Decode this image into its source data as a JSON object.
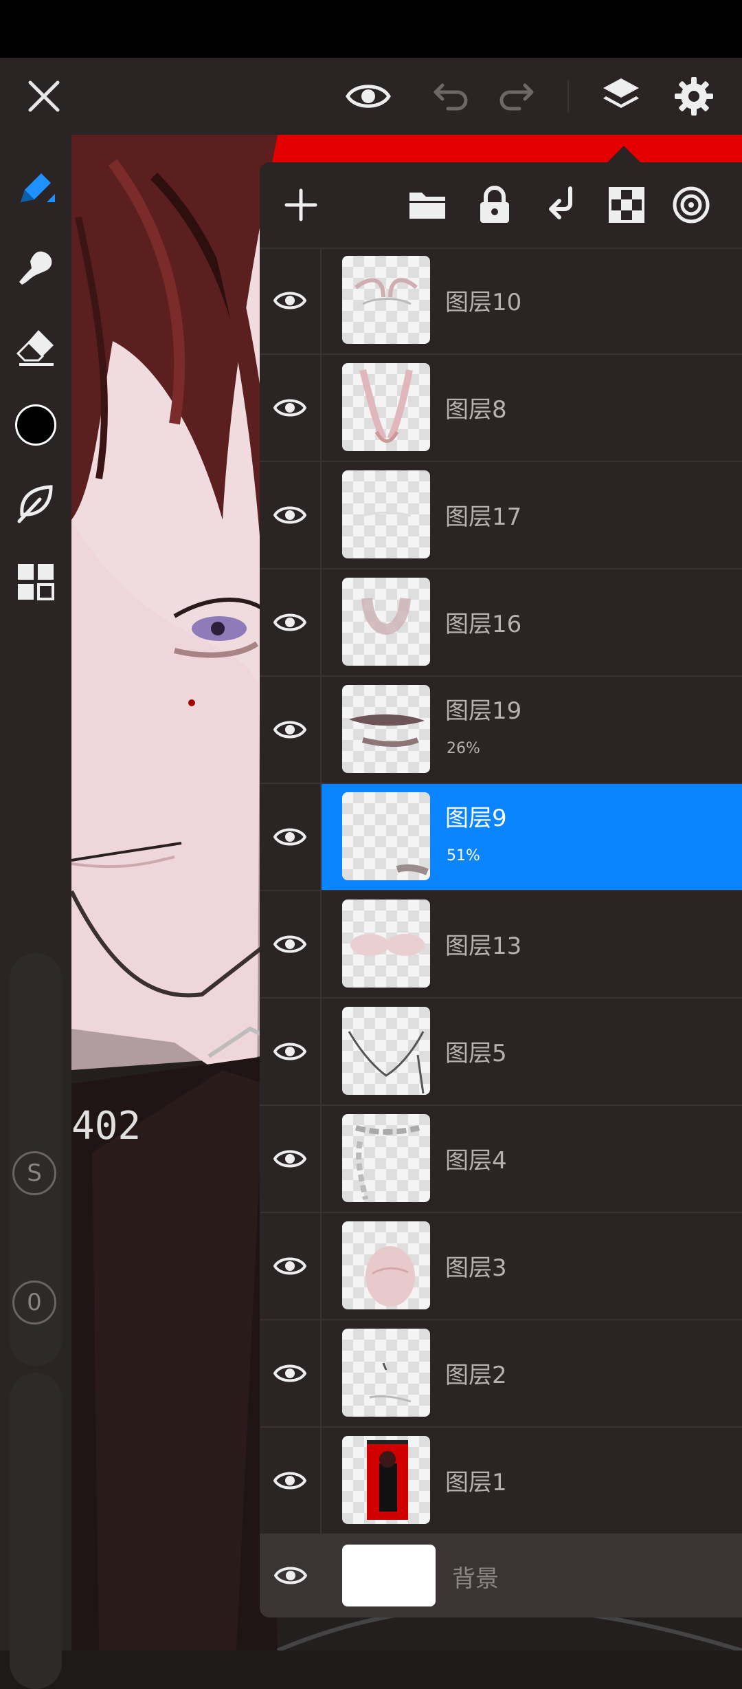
{
  "topbar": {
    "close_icon": "close-icon",
    "preview_icon": "eye-icon",
    "undo_icon": "undo-icon",
    "redo_icon": "redo-icon",
    "layers_icon": "layers-icon",
    "settings_icon": "gear-icon"
  },
  "tools": [
    {
      "name": "pen-tool",
      "icon": "pen-icon",
      "active": true
    },
    {
      "name": "smudge-tool",
      "icon": "smudge-icon"
    },
    {
      "name": "eraser-tool",
      "icon": "eraser-icon"
    },
    {
      "name": "color-picker",
      "icon": "color-swatch",
      "color": "#000000"
    },
    {
      "name": "brush-library",
      "icon": "leaf-icon"
    },
    {
      "name": "more-tools",
      "icon": "grid-icon"
    }
  ],
  "sliders": {
    "size_label": "S",
    "opacity_label": "0"
  },
  "layer_toolbar": {
    "add": "plus-icon",
    "folder": "folder-icon",
    "lock": "lock-icon",
    "merge": "merge-down-icon",
    "transparency": "checker-icon",
    "blend": "blend-mode-icon"
  },
  "layers": [
    {
      "name": "图层10",
      "opacity": "",
      "visible": true,
      "selected": false
    },
    {
      "name": "图层8",
      "opacity": "",
      "visible": true,
      "selected": false
    },
    {
      "name": "图层17",
      "opacity": "",
      "visible": true,
      "selected": false
    },
    {
      "name": "图层16",
      "opacity": "",
      "visible": true,
      "selected": false
    },
    {
      "name": "图层19",
      "opacity": "26%",
      "visible": true,
      "selected": false
    },
    {
      "name": "图层9",
      "opacity": "51%",
      "visible": true,
      "selected": true
    },
    {
      "name": "图层13",
      "opacity": "",
      "visible": true,
      "selected": false
    },
    {
      "name": "图层5",
      "opacity": "",
      "visible": true,
      "selected": false
    },
    {
      "name": "图层4",
      "opacity": "",
      "visible": true,
      "selected": false
    },
    {
      "name": "图层3",
      "opacity": "",
      "visible": true,
      "selected": false
    },
    {
      "name": "图层2",
      "opacity": "",
      "visible": true,
      "selected": false
    },
    {
      "name": "图层1",
      "opacity": "",
      "visible": true,
      "selected": false
    }
  ],
  "background_layer": {
    "name": "背景",
    "visible": true
  },
  "colors": {
    "accent": "#0a84ff",
    "canvas_red": "#e40000",
    "panel": "#2b2424"
  }
}
